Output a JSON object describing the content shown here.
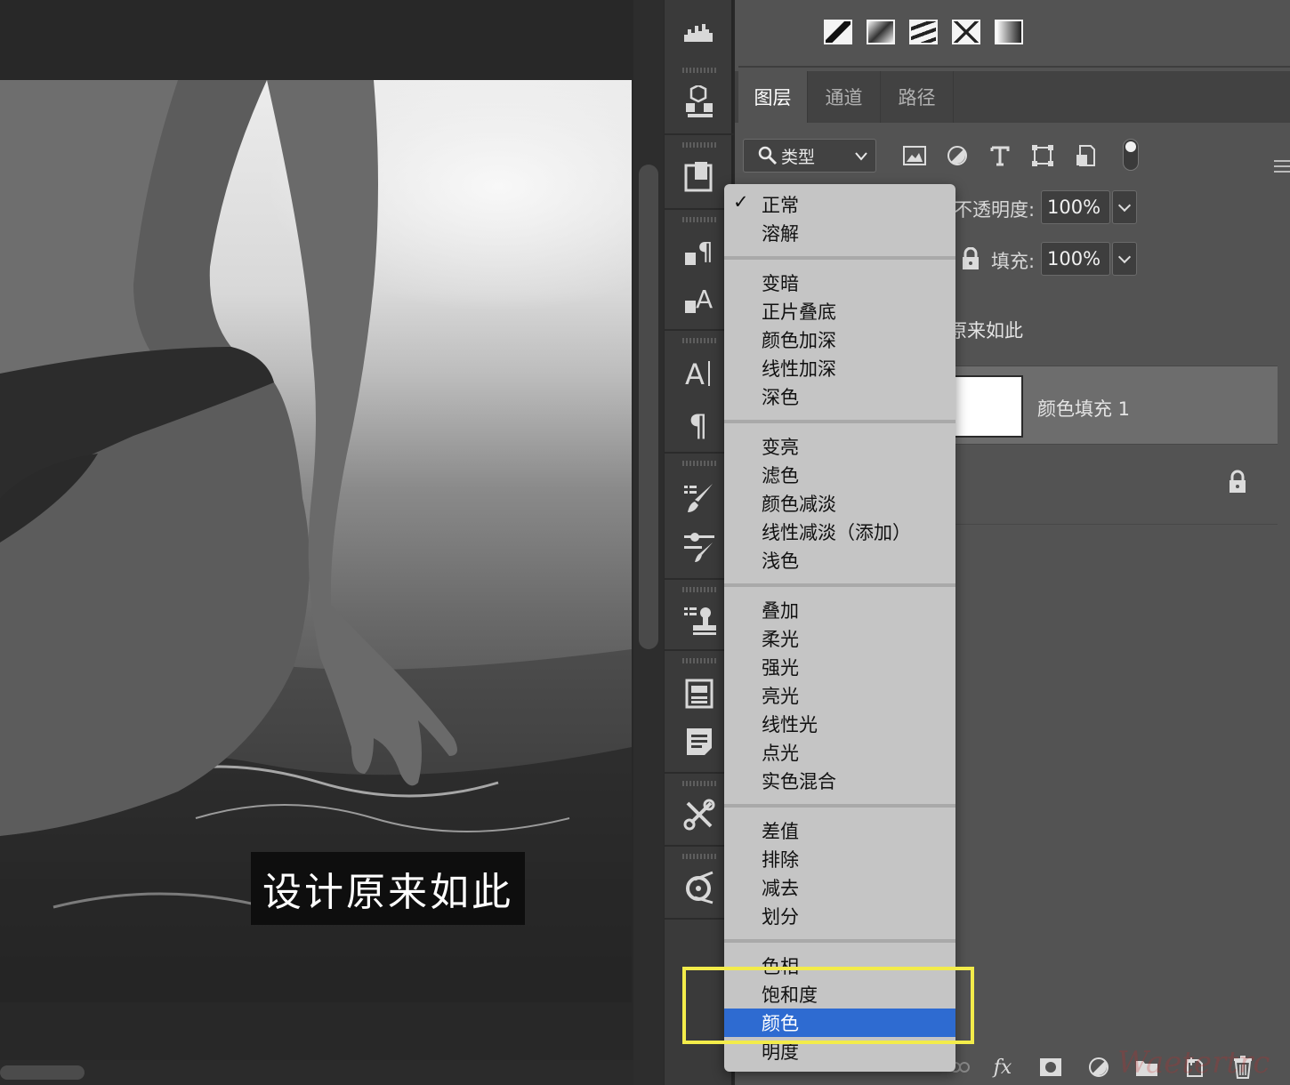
{
  "canvas": {
    "caption_text": "设计原来如此"
  },
  "toolbar": {
    "tools": [
      "histogram-icon",
      "3d-icon",
      "history-icon",
      "paragraph-style-icon",
      "character-style-icon",
      "character-icon",
      "paragraph-icon",
      "brush-settings-icon",
      "brush-presets-icon",
      "clone-source-icon",
      "properties-icon",
      "notes-icon",
      "tool-presets-icon",
      "adjust-curves-icon"
    ]
  },
  "adjustments": {
    "icons": [
      "levels-icon",
      "gradient-map-icon",
      "posterize-icon",
      "threshold-icon",
      "gradient-icon"
    ]
  },
  "tabs": [
    {
      "label": "图层",
      "active": true
    },
    {
      "label": "通道",
      "active": false
    },
    {
      "label": "路径",
      "active": false
    }
  ],
  "filter": {
    "selected": "类型",
    "icons": [
      "image-filter-icon",
      "adjustment-filter-icon",
      "type-filter-icon",
      "shape-filter-icon",
      "smart-object-filter-icon"
    ]
  },
  "opacity": {
    "label": "不透明度:",
    "value": "100%"
  },
  "fill": {
    "label": "填充:",
    "value": "100%"
  },
  "layers": [
    {
      "name": "原来如此"
    },
    {
      "name": "颜色填充 1"
    },
    {
      "name": ""
    }
  ],
  "blend_menu": {
    "groups": [
      [
        "正常",
        "溶解"
      ],
      [
        "变暗",
        "正片叠底",
        "颜色加深",
        "线性加深",
        "深色"
      ],
      [
        "变亮",
        "滤色",
        "颜色减淡",
        "线性减淡（添加）",
        "浅色"
      ],
      [
        "叠加",
        "柔光",
        "强光",
        "亮光",
        "线性光",
        "点光",
        "实色混合"
      ],
      [
        "差值",
        "排除",
        "减去",
        "划分"
      ],
      [
        "色相",
        "饱和度",
        "颜色",
        "明度"
      ]
    ],
    "checked": "正常",
    "selected": "颜色",
    "selected_color": "#2e6bd1"
  },
  "highlight_color": "#f3ec4a",
  "bottom_icons": [
    "link-layers-icon",
    "fx-icon",
    "add-mask-icon",
    "adjustment-layer-icon",
    "new-group-icon",
    "new-layer-icon",
    "delete-icon"
  ],
  "bottom_fx_label": "fx"
}
